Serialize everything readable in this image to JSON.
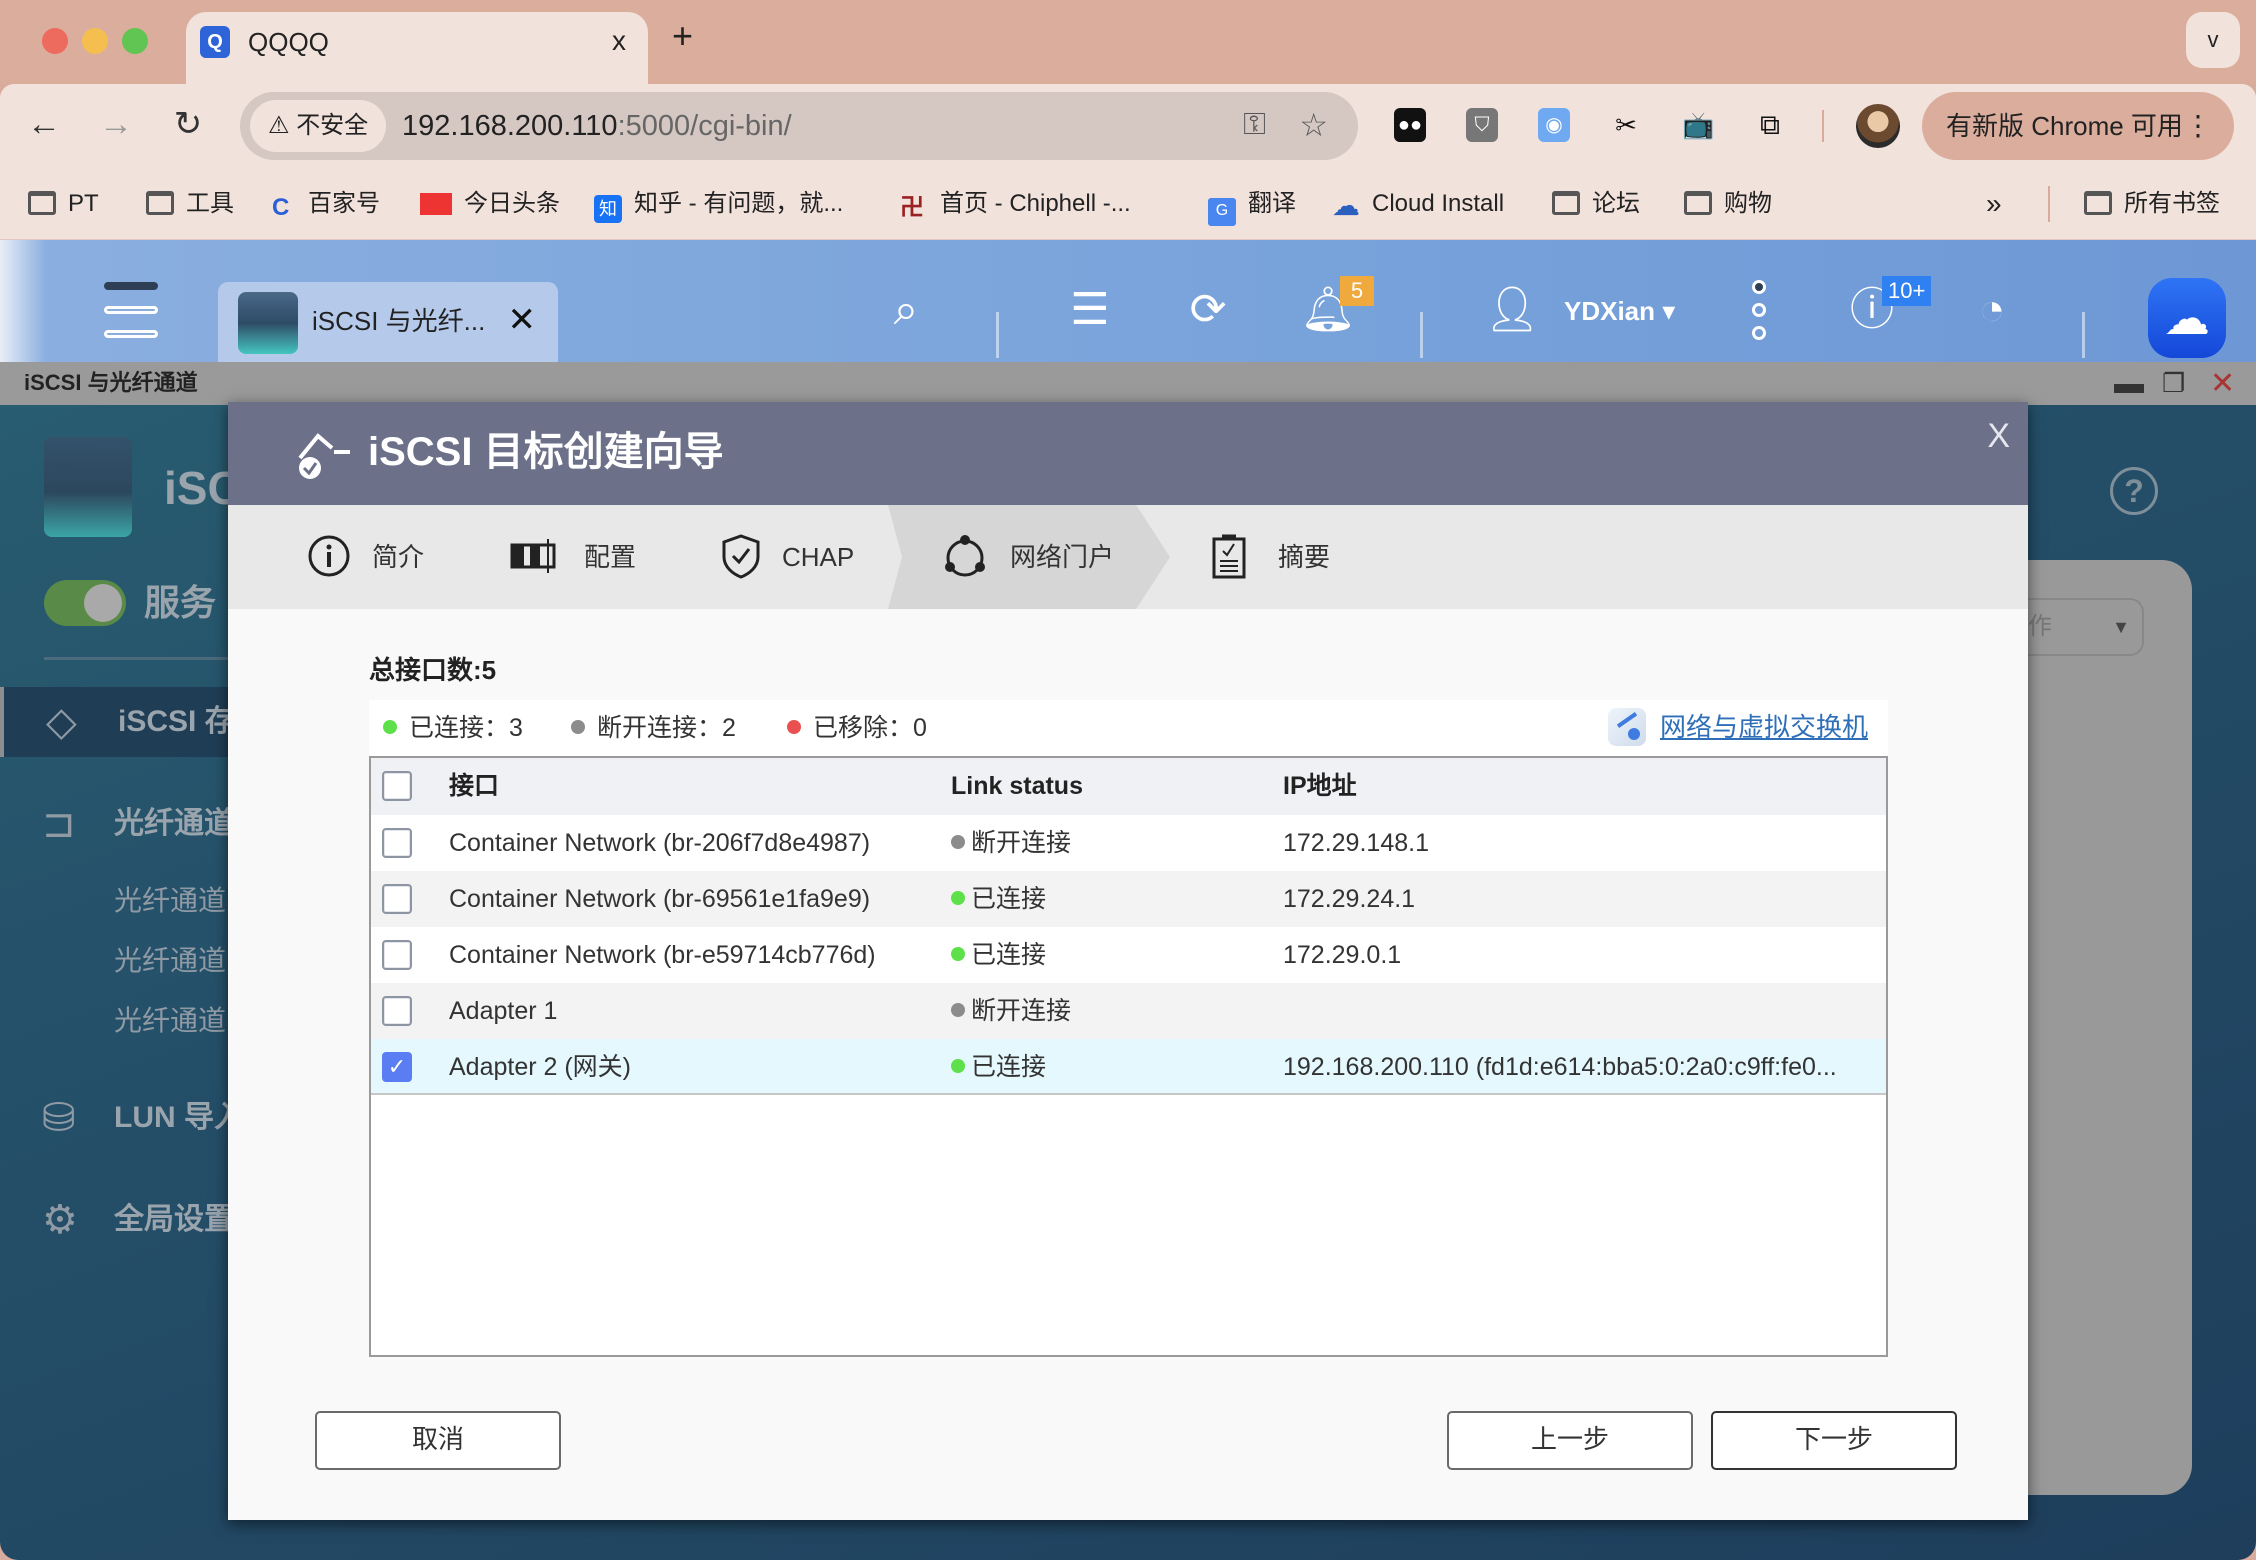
{
  "browser": {
    "tab_title": "QQQQ",
    "tab_close": "x",
    "new_tab": "+",
    "tab_menu": "v",
    "security_label": "不安全",
    "url_host": "192.168.200.110",
    "url_path": ":5000/cgi-bin/",
    "update_label": "有新版 Chrome 可用",
    "bookmarks": [
      {
        "label": "PT",
        "icon": "folder-icon"
      },
      {
        "label": "工具",
        "icon": "folder-icon"
      },
      {
        "label": "百家号",
        "icon": "baijiahao-icon"
      },
      {
        "label": "今日头条",
        "icon": "toutiao-icon"
      },
      {
        "label": "知乎 - 有问题，就...",
        "icon": "zhihu-icon"
      },
      {
        "label": "首页 - Chiphell -...",
        "icon": "chiphell-icon"
      },
      {
        "label": "翻译",
        "icon": "google-translate-icon"
      },
      {
        "label": "Cloud Install",
        "icon": "cloud-install-icon"
      },
      {
        "label": "论坛",
        "icon": "folder-icon"
      },
      {
        "label": "购物",
        "icon": "folder-icon"
      }
    ],
    "bookmarks_more": "»",
    "all_bookmarks": "所有书签"
  },
  "qts": {
    "app_tab_label": "iSCSI 与光纤...",
    "notification_count": "5",
    "user_name": "YDXian",
    "info_count": "10+",
    "window_title": "iSCSI 与光纤通道"
  },
  "app": {
    "title_partial": "iSC",
    "service_label": "服务",
    "service_enabled": true,
    "nav": [
      {
        "label": "iSCSI 存",
        "icon": "iscsi-storage-icon",
        "active": true
      },
      {
        "label": "光纤通道",
        "icon": "fibre-channel-icon"
      },
      {
        "label": "LUN 导入",
        "icon": "lun-import-icon"
      },
      {
        "label": "全局设置",
        "icon": "gear-icon"
      }
    ],
    "fc_sub_items": [
      "光纤通道",
      "光纤通道",
      "光纤通道"
    ],
    "bg_select_partial": "作"
  },
  "wizard": {
    "title": "iSCSI 目标创建向导",
    "close": "X",
    "steps": [
      {
        "label": "简介",
        "icon": "info-icon"
      },
      {
        "label": "配置",
        "icon": "config-icon"
      },
      {
        "label": "CHAP",
        "icon": "shield-check-icon"
      },
      {
        "label": "网络门户",
        "icon": "network-portal-icon",
        "active": true
      },
      {
        "label": "摘要",
        "icon": "summary-clipboard-icon"
      }
    ],
    "total_label": "总接口数:5",
    "legend": {
      "connected": "已连接：3",
      "disconnected": "断开连接：2",
      "removed": "已移除：0"
    },
    "status_colors": {
      "connected": "#5ee04a",
      "disconnected": "#8c8c8c",
      "removed": "#ea5050"
    },
    "network_link": "网络与虚拟交换机",
    "columns": [
      "接口",
      "Link status",
      "IP地址"
    ],
    "rows": [
      {
        "interface": "Container Network (br-206f7d8e4987)",
        "status": "断开连接",
        "state": "disconnected",
        "ip": "172.29.148.1",
        "checked": false
      },
      {
        "interface": "Container Network (br-69561e1fa9e9)",
        "status": "已连接",
        "state": "connected",
        "ip": "172.29.24.1",
        "checked": false
      },
      {
        "interface": "Container Network (br-e59714cb776d)",
        "status": "已连接",
        "state": "connected",
        "ip": "172.29.0.1",
        "checked": false
      },
      {
        "interface": "Adapter 1",
        "status": "断开连接",
        "state": "disconnected",
        "ip": "",
        "checked": false
      },
      {
        "interface": "Adapter 2 (网关)",
        "status": "已连接",
        "state": "connected",
        "ip": "192.168.200.110 (fd1d:e614:bba5:0:2a0:c9ff:fe0...",
        "checked": true
      }
    ],
    "buttons": {
      "cancel": "取消",
      "prev": "上一步",
      "next": "下一步"
    }
  }
}
